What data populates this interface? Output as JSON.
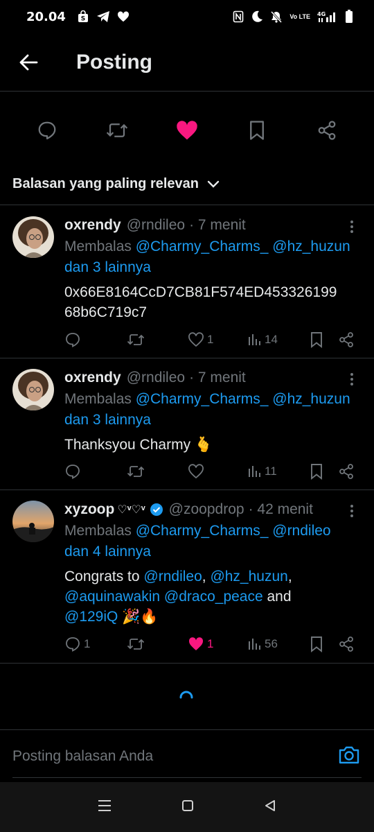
{
  "status_bar": {
    "time": "20.04",
    "network": "4G",
    "volte": "Vo LTE"
  },
  "header": {
    "title": "Posting"
  },
  "sort": {
    "label": "Balasan yang paling relevan"
  },
  "replies": [
    {
      "name": "oxrendy",
      "handle": "@rndileo",
      "time": "· 7 menit",
      "reply_prefix": "Membalas ",
      "mention1": "@Charmy_Charms_",
      "mention2": "@hz_huzun",
      "others": "dan 3 lainnya",
      "text_line1": "0x66E8164CcD7CB81F574ED453326199",
      "text_line2": "68b6C719c7",
      "reply_count": "",
      "like_count": "1",
      "views": "14"
    },
    {
      "name": "oxrendy",
      "handle": "@rndileo",
      "time": "· 7 menit",
      "reply_prefix": "Membalas ",
      "mention1": "@Charmy_Charms_",
      "mention2": "@hz_huzun",
      "others": "dan 3 lainnya",
      "text": "Thanksyou Charmy 🫰",
      "reply_count": "",
      "like_count": "",
      "views": "11"
    },
    {
      "name": "xyzoop",
      "name_suffix": "♡ᵛ♡ᵛ",
      "handle": "@zoopdrop",
      "time": "· 42 menit",
      "reply_prefix": "Membalas ",
      "mention1": "@Charmy_Charms_",
      "mention2": "@rndileo",
      "others": "dan 4 lainnya",
      "t1_a": "Congrats to ",
      "t1_b": "@rndileo",
      "t1_c": ", ",
      "t1_d": "@hz_huzun",
      "t1_e": ",",
      "t2_a": "@aquinawakin",
      "t2_b": " ",
      "t2_c": "@draco_peace",
      "t2_d": " and",
      "t3_a": "@129iQ",
      "t3_b": " 🎉🔥",
      "reply_count": "1",
      "like_count": "1",
      "views": "56"
    }
  ],
  "composer": {
    "placeholder": "Posting balasan Anda"
  },
  "colors": {
    "accent": "#1d9bf0",
    "like": "#f91880",
    "muted": "#71767b",
    "background": "#000000"
  }
}
